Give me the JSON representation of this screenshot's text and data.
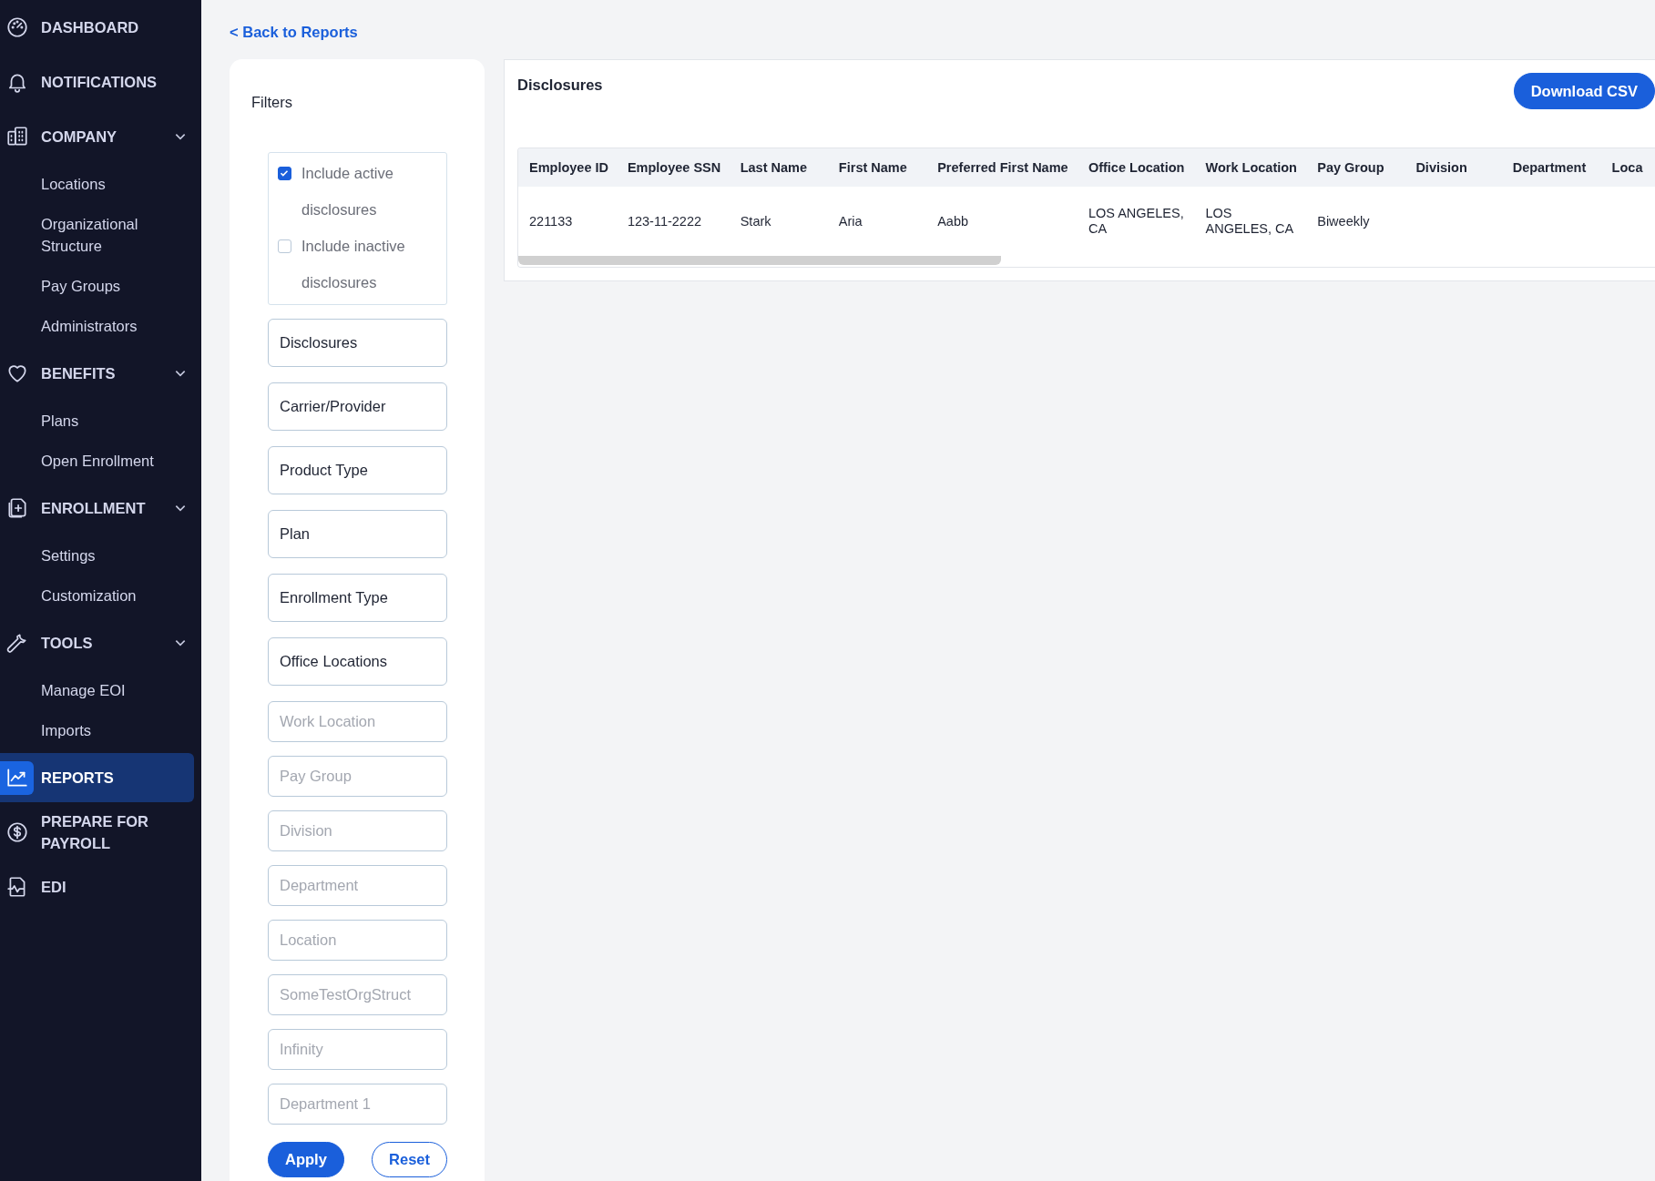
{
  "sidebar": {
    "items": [
      {
        "label": "DASHBOARD",
        "selected": false
      },
      {
        "label": "NOTIFICATIONS",
        "selected": false
      },
      {
        "label": "COMPANY",
        "selected": false,
        "expanded": true,
        "children": [
          {
            "label": "Locations",
            "selected": false
          },
          {
            "label": "Organizational Structure",
            "selected": false
          },
          {
            "label": "Pay Groups",
            "selected": false
          },
          {
            "label": "Administrators",
            "selected": false
          }
        ]
      },
      {
        "label": "BENEFITS",
        "selected": false,
        "expanded": true,
        "children": [
          {
            "label": "Plans",
            "selected": false
          },
          {
            "label": "Open Enrollment",
            "selected": false
          }
        ]
      },
      {
        "label": "ENROLLMENT",
        "selected": false,
        "expanded": true,
        "children": [
          {
            "label": "Settings",
            "selected": false
          },
          {
            "label": "Customization",
            "selected": false
          }
        ]
      },
      {
        "label": "TOOLS",
        "selected": false,
        "expanded": true,
        "children": [
          {
            "label": "Manage EOI",
            "selected": false
          },
          {
            "label": "Imports",
            "selected": false
          }
        ]
      },
      {
        "label": "REPORTS",
        "selected": true
      },
      {
        "label": "PREPARE FOR PAYROLL",
        "selected": false
      },
      {
        "label": "EDI",
        "selected": false
      }
    ]
  },
  "back_link": "< Back to Reports",
  "filters": {
    "title": "Filters",
    "checkboxes": [
      {
        "label": "Include active disclosures",
        "checked": true
      },
      {
        "label": "Include inactive disclosures",
        "checked": false
      }
    ],
    "fields": [
      {
        "value": "Disclosures"
      },
      {
        "value": "Carrier/Provider"
      },
      {
        "value": "Product Type"
      },
      {
        "value": "Plan"
      },
      {
        "value": "Enrollment Type"
      },
      {
        "value": "Office Locations"
      },
      {
        "placeholder": "Work Location"
      },
      {
        "placeholder": "Pay Group"
      },
      {
        "placeholder": "Division"
      },
      {
        "placeholder": "Department"
      },
      {
        "placeholder": "Location"
      },
      {
        "placeholder": "SomeTestOrgStruct"
      },
      {
        "placeholder": "Infinity"
      },
      {
        "placeholder": "Department 1"
      }
    ],
    "buttons": [
      {
        "label": "Apply",
        "kind": "primary"
      },
      {
        "label": "Reset",
        "kind": "outline"
      }
    ]
  },
  "report": {
    "title": "Disclosures",
    "download_button": "Download CSV",
    "table": {
      "columns": [
        "Employee ID",
        "Employee SSN",
        "Last Name",
        "First Name",
        "Preferred First Name",
        "Office Location",
        "Work Location",
        "Pay Group",
        "Division",
        "Department",
        "Loca"
      ],
      "rows": [
        [
          "221133",
          "123-11-2222",
          "Stark",
          "Aria",
          "Aabb",
          "LOS ANGELES, CA",
          "LOS ANGELES, CA",
          "Biweekly",
          "",
          "",
          ""
        ]
      ]
    }
  }
}
